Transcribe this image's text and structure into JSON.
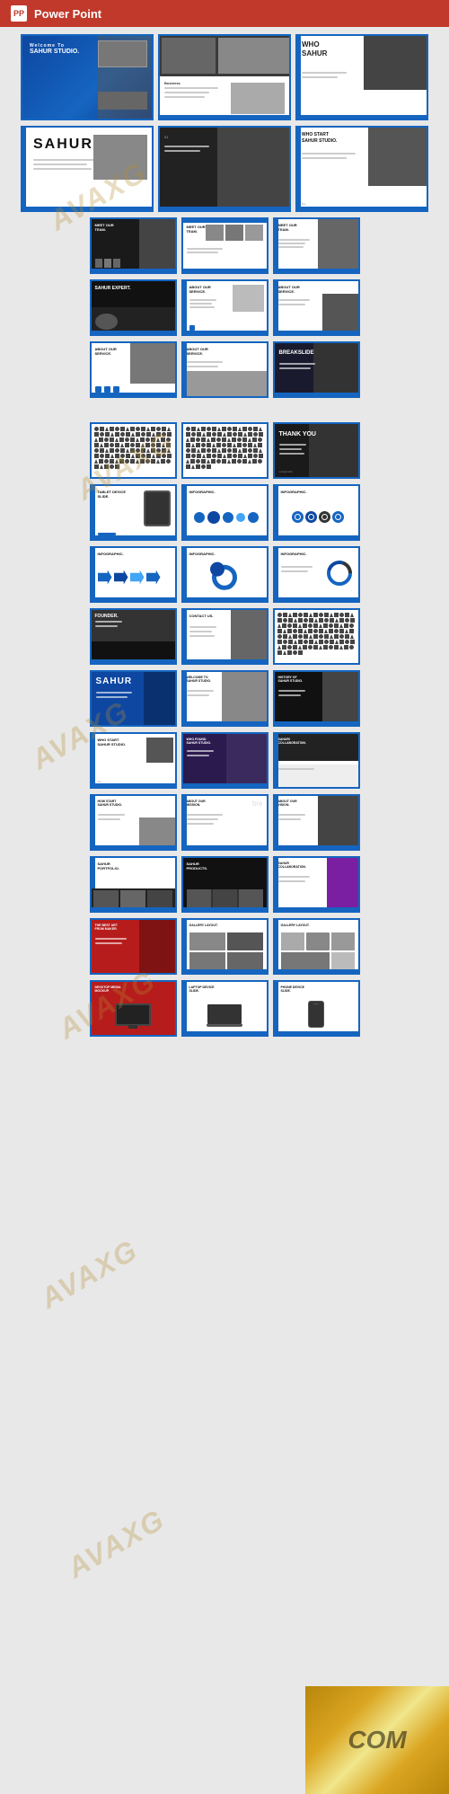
{
  "header": {
    "title": "Power Point",
    "icon_text": "PP"
  },
  "watermark": {
    "texts": [
      "AVAXG",
      "AVAXG",
      "AVAXG",
      "AVAXG",
      "AVAXG",
      "AVAXG"
    ],
    "com_text": "COM",
    "avax_label": "AVAXG"
  },
  "slides": {
    "row1": [
      {
        "id": "s1",
        "type": "hero-blue",
        "title": "Welcome To SAHUR Studio."
      },
      {
        "id": "s2",
        "type": "photo-top",
        "title": ""
      },
      {
        "id": "s3",
        "type": "photo-right",
        "title": ""
      }
    ],
    "row2": [
      {
        "id": "s4",
        "type": "sahur-title",
        "title": "SAHUR"
      },
      {
        "id": "s5",
        "type": "photo-dark",
        "title": ""
      },
      {
        "id": "s6",
        "type": "who-start",
        "title": "WHO START SAHUR STUDIO."
      }
    ],
    "row3": [
      {
        "id": "s7",
        "type": "meet-team-dark",
        "title": "MEET OUR TEAM."
      },
      {
        "id": "s8",
        "type": "meet-team-white",
        "title": "MEET OUR TEAM."
      },
      {
        "id": "s9",
        "type": "meet-team-photo",
        "title": "MEET OUR TEAM."
      }
    ],
    "row4": [
      {
        "id": "s10",
        "type": "sahur-expert-dark",
        "title": "SAHUR EXPERT."
      },
      {
        "id": "s11",
        "type": "about-service-white",
        "title": "ABOUT OUR SERVICE."
      },
      {
        "id": "s12",
        "type": "about-service-photo",
        "title": "ABOUT OUR SERVICE."
      }
    ],
    "row5": [
      {
        "id": "s13",
        "type": "about-service-office",
        "title": "ABOUT OUR SERVICE."
      },
      {
        "id": "s14",
        "type": "about-service-team",
        "title": "ABOUT OUR SERVICE."
      },
      {
        "id": "s15",
        "type": "breakslide",
        "title": "BREAKSLIDE"
      }
    ],
    "row6_spacer": true,
    "row7": [
      {
        "id": "s16",
        "type": "icon-grid-1",
        "title": ""
      },
      {
        "id": "s17",
        "type": "icon-grid-2",
        "title": ""
      },
      {
        "id": "s18",
        "type": "thank-you",
        "title": "THANK YOU"
      }
    ],
    "row8": [
      {
        "id": "s19",
        "type": "tablet-device",
        "title": "TABLET DEVICE SLIDE."
      },
      {
        "id": "s20",
        "type": "infographic-1",
        "title": "INFOGRAPHIC."
      },
      {
        "id": "s21",
        "type": "infographic-circles",
        "title": "INFOGRAPHIC."
      }
    ],
    "row9": [
      {
        "id": "s22",
        "type": "infographic-arrows",
        "title": "INFOGRAPHIC."
      },
      {
        "id": "s23",
        "type": "infographic-ring",
        "title": "INFOGRAPHIC."
      },
      {
        "id": "s24",
        "type": "infographic-pie",
        "title": "INFOGRAPHIC."
      }
    ],
    "row10": [
      {
        "id": "s25",
        "type": "founder-dark",
        "title": "FOUNDER."
      },
      {
        "id": "s26",
        "type": "contact-us",
        "title": "CONTACT US."
      },
      {
        "id": "s27",
        "type": "icon-grid-3",
        "title": ""
      }
    ],
    "row11": [
      {
        "id": "s28",
        "type": "sahur-blue",
        "title": "SAHUR"
      },
      {
        "id": "s29",
        "type": "welcome-office",
        "title": "WELCOME TO SAHUR STUDIO."
      },
      {
        "id": "s30",
        "type": "history",
        "title": "HISTORY OF SAHUR STUDIO."
      }
    ],
    "row12": [
      {
        "id": "s31",
        "type": "who-start-2",
        "title": "WHO START SAHUR STUDIO."
      },
      {
        "id": "s32",
        "type": "who-found",
        "title": "WHO FOUND SAHUR STUDIO."
      }
    ],
    "row12b": [
      {
        "id": "s33",
        "type": "sahur-collab",
        "title": "SAHUR COLLABORATION."
      }
    ],
    "row13": [
      {
        "id": "s34",
        "type": "how-start",
        "title": "HOW START SAHUR STUDIO."
      },
      {
        "id": "s35",
        "type": "about-mission",
        "title": "ABOUT OUR MISSION."
      },
      {
        "id": "s36",
        "type": "about-vision",
        "title": "ABOUT OUR VISION."
      }
    ],
    "row14": [
      {
        "id": "s37",
        "type": "portfolio",
        "title": "SAHUR PORTFOLIO."
      },
      {
        "id": "s38",
        "type": "products",
        "title": "SAHUR PRODUCTS."
      },
      {
        "id": "s39",
        "type": "collab-2",
        "title": "SAHUR COLLABORATION."
      }
    ],
    "row15": [
      {
        "id": "s40",
        "type": "best-art",
        "title": "THE BEST ART FROM MAKER."
      },
      {
        "id": "s41",
        "type": "gallery-1",
        "title": "GALLERY LAYOUT."
      },
      {
        "id": "s42",
        "type": "gallery-2",
        "title": "GALLERY LAYOUT."
      }
    ],
    "row16": [
      {
        "id": "s43",
        "type": "desktop-mockup",
        "title": "DESKTOP MEDIA MOCKUP."
      },
      {
        "id": "s44",
        "type": "laptop-mockup",
        "title": "LAPTOP DEVICE SLIDE."
      },
      {
        "id": "s45",
        "type": "phone-mockup",
        "title": "PHONE DEVICE SLIDE."
      }
    ]
  }
}
